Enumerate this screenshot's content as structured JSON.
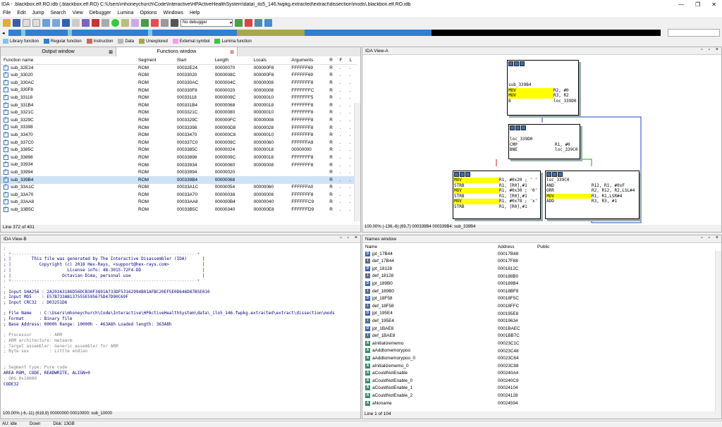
{
  "window": {
    "title": "IDA - .blackbox.elf.RO.idb (.blackbox.elf.RO) C:\\Users\\mhoneychurch\\Code\\Interactive\\HPActiveHealthSystem\\data\\_ilo5_146.fwpkg.extracted\\extract\\dissection\\mods\\.blackbox.elf.RO.idb",
    "min": "—",
    "max": "❐",
    "close": "✕"
  },
  "menu": [
    "File",
    "Edit",
    "Jump",
    "Search",
    "View",
    "Debugger",
    "Lumina",
    "Options",
    "Windows",
    "Help"
  ],
  "toolbar": {
    "debugger": "No debugger"
  },
  "legend": [
    {
      "label": "Library function",
      "color": "#7ec8e3"
    },
    {
      "label": "Regular function",
      "color": "#2f7fd3"
    },
    {
      "label": "Instruction",
      "color": "#c07050"
    },
    {
      "label": "Data",
      "color": "#b8b8b8"
    },
    {
      "label": "Unexplored",
      "color": "#a8a848"
    },
    {
      "label": "External symbol",
      "color": "#f49cf4"
    },
    {
      "label": "Lumina function",
      "color": "#38c838"
    }
  ],
  "left_tabs": {
    "output": "Output window",
    "functions": "Functions window"
  },
  "functions": {
    "columns": [
      "Function name",
      "Segment",
      "Start",
      "Length",
      "Locals",
      "Arguments",
      "R",
      "F",
      "L"
    ],
    "rows": [
      [
        "sub_32E24",
        "ROM",
        "00032E24",
        "00000070",
        "000000F8",
        "FFFFFF69",
        "R",
        ".",
        "."
      ],
      [
        "sub_33020",
        "ROM",
        "00033020",
        "0000008C",
        "000000F8",
        "FFFFFF69",
        "R",
        ".",
        "."
      ],
      [
        "sub_330AC",
        "ROM",
        "000330AC",
        "0000004C",
        "00000008",
        "FFFFFFF8",
        "R",
        ".",
        "."
      ],
      [
        "sub_330F8",
        "ROM",
        "000330F8",
        "00000020",
        "00000008",
        "FFFFFFFC",
        "R",
        ".",
        "."
      ],
      [
        "sub_33118",
        "ROM",
        "00033118",
        "0000009C",
        "00000010",
        "FFFFFFF5",
        "R",
        ".",
        "."
      ],
      [
        "sub_331B4",
        "ROM",
        "000331B4",
        "00000068",
        "00000018",
        "FFFFFFF8",
        "R",
        ".",
        "."
      ],
      [
        "sub_3321C",
        "ROM",
        "0003321C",
        "00000080",
        "00000010",
        "FFFFFFF8",
        "R",
        ".",
        "."
      ],
      [
        "sub_3329C",
        "ROM",
        "0003329C",
        "000000FC",
        "00000008",
        "FFFFFFF8",
        "R",
        ".",
        "."
      ],
      [
        "sub_33398",
        "ROM",
        "00033398",
        "000000D8",
        "00000028",
        "FFFFFFF8",
        "R",
        ".",
        "."
      ],
      [
        "sub_33470",
        "ROM",
        "00033470",
        "000000C8",
        "00000010",
        "FFFFFFF8",
        "R",
        ".",
        "."
      ],
      [
        "sub_337C0",
        "ROM",
        "000337C0",
        "0000009C",
        "00000060",
        "FFFFFFA9",
        "R",
        ".",
        "."
      ],
      [
        "sub_3385C",
        "ROM",
        "0003385C",
        "00000024",
        "00000018",
        "00000000",
        "R",
        ".",
        "."
      ],
      [
        "sub_33898",
        "ROM",
        "00033898",
        "0000009C",
        "00000018",
        "FFFFFFF8",
        "R",
        ".",
        "."
      ],
      [
        "sub_33934",
        "ROM",
        "00033934",
        "00000060",
        "00000008",
        "FFFFFFF8",
        "R",
        ".",
        "."
      ],
      [
        "sub_33994",
        "ROM",
        "00033994",
        "00000020",
        "",
        "",
        "R",
        ".",
        "."
      ],
      [
        "sub_339B4",
        "ROM",
        "000339B4",
        "00000068",
        "",
        "",
        "R",
        ".",
        "."
      ],
      [
        "sub_33A1C",
        "ROM",
        "00033A1C",
        "00000054",
        "00000060",
        "FFFFFFA0",
        "R",
        ".",
        "."
      ],
      [
        "sub_33A70",
        "ROM",
        "00033A70",
        "00000038",
        "00000008",
        "FFFFFFF8",
        "R",
        ".",
        "."
      ],
      [
        "sub_33AA8",
        "ROM",
        "00033AA8",
        "000000B4",
        "00000040",
        "FFFFFFC9",
        "R",
        ".",
        "."
      ],
      [
        "sub_33B5C",
        "ROM",
        "00033B5C",
        "00000340",
        "000000E8",
        "FFFFFFD9",
        "R",
        ".",
        "."
      ]
    ],
    "selected_index": 15,
    "status": "Line 372 of 401"
  },
  "ida_view_a": {
    "title": "IDA View-A",
    "status": "100.00% (-136,-6) (69,7) 000339B4 000339B4: sub_339B4",
    "node1": [
      "sub_339B4",
      "MOV|R2, #0",
      "MOV|R3, R2",
      "B|loc_339D0"
    ],
    "node2": [
      "loc_339D0",
      "CMP|R1, #0",
      "BNE|loc_339C0"
    ],
    "node3": [
      "MOV|R1, #0x20 ; ' '",
      "STRB|R1, [R0],#1",
      "MOV|R1, #0x30 ; '0'",
      "STRB|R1, [R0],#1",
      "MOV|R1, #0x78 ; 'x'",
      "STRB|R1, [R0],#1"
    ],
    "node4": [
      "loc_339C0",
      "AND|R12, R1, #0xF",
      "ORR|R2, R12, R2,LSL#4",
      "MOV|R1, R1,LSR#4",
      "ADD|R3, R3, #1"
    ]
  },
  "ida_view_b": {
    "title": "IDA View-B",
    "status": "100.00% (-6,-11) (619,9) 00000000 00010000: sub_10000",
    "lines": [
      {
        "c": "g",
        "t": ";"
      },
      {
        "c": "g",
        "t": "; +-------------------------------------------------------------------------+"
      },
      {
        "c": "",
        "t": "; |        This file was generated by The Interactive Disassembler (IDA)      |"
      },
      {
        "c": "",
        "t": "; |           Copyright (c) 2018 Hex-Rays, <support@hex-rays.com>             |"
      },
      {
        "c": "",
        "t": "; |                      License info: 48-3015-72F4-DD                        |"
      },
      {
        "c": "",
        "t": "; |                    Octavian Dima, personal use                            |"
      },
      {
        "c": "g",
        "t": "; +-------------------------------------------------------------------------+"
      },
      {
        "c": "g",
        "t": ";"
      },
      {
        "c": "",
        "t": "; Input SHA256 : 2A202A3186D56DCB30F3891A733DF53162994B01AFBC20EF5E0D646D87B5E010"
      },
      {
        "c": "",
        "t": "; Input MD5    : E57B733AB137555E595675D47D90C69F"
      },
      {
        "c": "",
        "t": "; Input CRC32  : D03251D6"
      },
      {
        "c": "",
        "t": ""
      },
      {
        "c": "",
        "t": "; File Name   : C:\\Users\\mhoneychurch\\Code\\Interactive\\HPActiveHealthSystem\\data\\_ilo5_146.fwpkg.extracted\\extract\\dissection\\mods"
      },
      {
        "c": "",
        "t": "; Format      : Binary file"
      },
      {
        "c": "",
        "t": "; Base Address: 0000h Range: 10000h - 463A8h Loaded length: 363A8h"
      },
      {
        "c": "",
        "t": ""
      },
      {
        "c": "g",
        "t": "; Processor       : ARM"
      },
      {
        "c": "g",
        "t": "; ARM architecture: metaarm"
      },
      {
        "c": "g",
        "t": "; Target assembler: Generic assembler for ARM"
      },
      {
        "c": "g",
        "t": "; Byte sex        : Little endian"
      },
      {
        "c": "",
        "t": ""
      },
      {
        "c": "",
        "t": ""
      },
      {
        "c": "g",
        "t": "; Segment type: Pure code"
      },
      {
        "c": "",
        "t": "AREA ROM, CODE, READWRITE, ALIGN=0"
      },
      {
        "c": "g",
        "t": "; ORG 0x10000"
      },
      {
        "c": "",
        "t": "CODE32"
      }
    ]
  },
  "names": {
    "title": "Names window",
    "columns": [
      "Name",
      "Address",
      "Public"
    ],
    "rows": [
      [
        "D",
        "jpt_17B44",
        "00017B48"
      ],
      [
        "i",
        "def_17B44",
        "00017F88"
      ],
      [
        "D",
        "jpt_18128",
        "0001812C"
      ],
      [
        "i",
        "def_18128",
        "000188B0"
      ],
      [
        "D",
        "jpt_189B0",
        "000189B4"
      ],
      [
        "i",
        "def_189B0",
        "00018BF8"
      ],
      [
        "D",
        "jpt_18F58",
        "00018F5C"
      ],
      [
        "i",
        "def_18F58",
        "00018FFC"
      ],
      [
        "D",
        "jpt_195E4",
        "000195E8"
      ],
      [
        "i",
        "def_195E4",
        "00019634"
      ],
      [
        "D",
        "jpt_1BAE8",
        "0001BAEC"
      ],
      [
        "i",
        "def_1BAE8",
        "0001BB7C"
      ],
      [
        "A",
        "aInitializememo",
        "00023C1C"
      ],
      [
        "A",
        "aAddtomemorypoo",
        "00023C48"
      ],
      [
        "A",
        "aAddtomemorypoo_0",
        "00023C64"
      ],
      [
        "A",
        "aInitializememo_0",
        "00023C88"
      ],
      [
        "A",
        "aCouldNotEnable",
        "000240A4"
      ],
      [
        "A",
        "aCouldNotEnable_0",
        "000240C8"
      ],
      [
        "A",
        "aCouldNotEnable_1",
        "00024104"
      ],
      [
        "A",
        "aCouldNotEnable_2",
        "00024128"
      ],
      [
        "A",
        "aNoname",
        "00024594"
      ]
    ],
    "status": "Line 1 of 104"
  },
  "statusbar": {
    "au": "AU:  idle",
    "dir": "Down",
    "disk": "Disk: 13GB"
  }
}
